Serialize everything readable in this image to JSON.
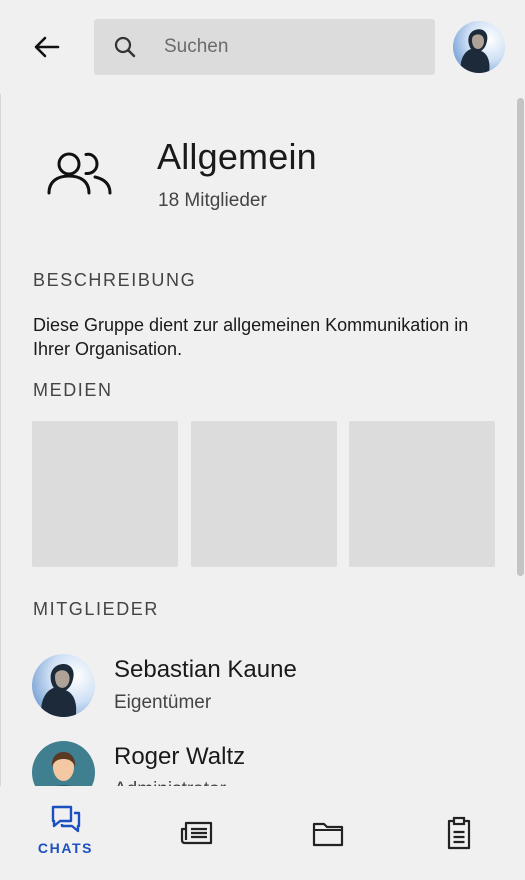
{
  "search": {
    "placeholder": "Suchen"
  },
  "group": {
    "title": "Allgemein",
    "member_count": "18 Mitglieder"
  },
  "sections": {
    "description_label": "BESCHREIBUNG",
    "description_text": "Diese Gruppe dient zur allgemeinen Kommunikation in Ihrer Organisation.",
    "media_label": "MEDIEN",
    "members_label": "MITGLIEDER"
  },
  "members": [
    {
      "name": "Sebastian Kaune",
      "role": "Eigentümer"
    },
    {
      "name": "Roger Waltz",
      "role": "Administrator"
    }
  ],
  "bottom_nav": {
    "chats_label": "CHATS"
  },
  "icons": {
    "back": "arrow-left-icon",
    "search": "search-icon",
    "group": "group-icon",
    "chats": "chat-bubbles-icon",
    "news": "newspaper-icon",
    "files": "folder-icon",
    "tasks": "clipboard-icon"
  },
  "colors": {
    "accent": "#1c4fc0",
    "background": "#f0f0f0",
    "placeholder_tile": "#dcdcdc"
  }
}
